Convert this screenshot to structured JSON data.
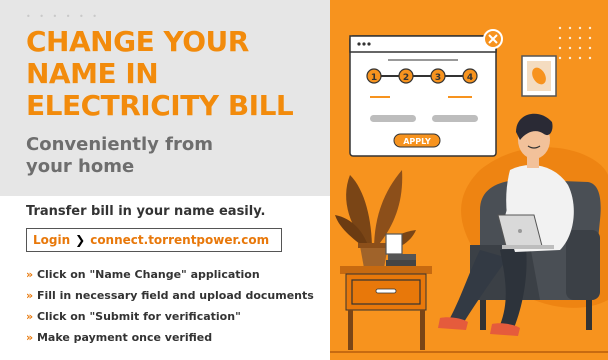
{
  "headline": {
    "line1": "CHANGE YOUR",
    "line2": "NAME IN",
    "line3": "ELECTRICITY BILL"
  },
  "subheadline": {
    "line1": "Conveniently from",
    "line2": "your home"
  },
  "description": "Transfer bill in your name easily.",
  "login": {
    "label": "Login",
    "arrow_icon": "chevron-right-icon",
    "url": "connect.torrentpower.com"
  },
  "steps": [
    "Click on \"Name Change\" application",
    "Fill in necessary field and upload documents",
    "Click on \"Submit for verification\"",
    "Make payment once verified"
  ],
  "illustration": {
    "wizard_steps": [
      "1",
      "2",
      "3",
      "4"
    ],
    "apply_label": "APPLY"
  },
  "colors": {
    "accent": "#f28b0c",
    "panel_bg": "#f7931e",
    "header_bg": "#e6e6e6"
  }
}
